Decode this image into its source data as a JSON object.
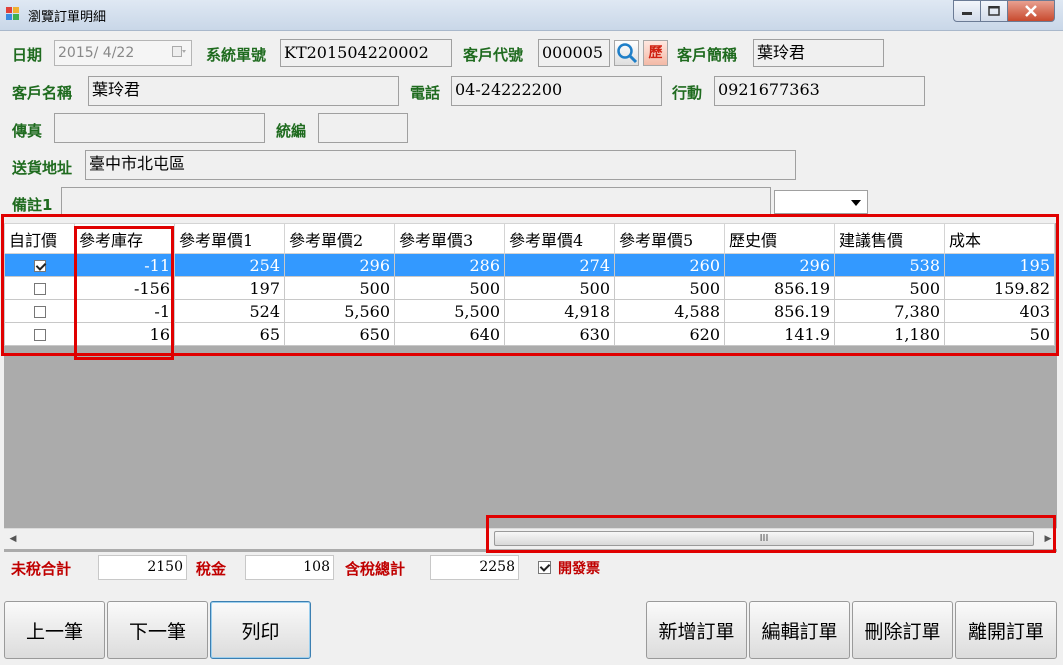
{
  "window": {
    "title": "瀏覽訂單明細"
  },
  "form": {
    "date_label": "日期",
    "date_value": "2015/ 4/22",
    "sysno_label": "系統單號",
    "sysno_value": "KT201504220002",
    "custcode_label": "客戶代號",
    "custcode_value": "000005",
    "history_btn": "歷",
    "shortname_label": "客戶簡稱",
    "shortname_value": "葉玲君",
    "custname_label": "客戶名稱",
    "custname_value": "葉玲君",
    "phone_label": "電話",
    "phone_value": "04-24222200",
    "mobile_label": "行動",
    "mobile_value": "0921677363",
    "fax_label": "傳真",
    "fax_value": "",
    "taxid_label": "統編",
    "taxid_value": "",
    "address_label": "送貨地址",
    "address_value": "臺中市北屯區",
    "note_label": "備註1",
    "note_value": ""
  },
  "grid": {
    "columns": [
      "自訂價",
      "參考庫存",
      "參考單價1",
      "參考單價2",
      "參考單價3",
      "參考單價4",
      "參考單價5",
      "歷史價",
      "建議售價",
      "成本"
    ],
    "rows": [
      {
        "checked": true,
        "cells": [
          "-11",
          "254",
          "296",
          "286",
          "274",
          "260",
          "296",
          "538",
          "195"
        ]
      },
      {
        "checked": false,
        "cells": [
          "-156",
          "197",
          "500",
          "500",
          "500",
          "500",
          "856.19",
          "500",
          "159.82"
        ]
      },
      {
        "checked": false,
        "cells": [
          "-1",
          "524",
          "5,560",
          "5,500",
          "4,918",
          "4,588",
          "856.19",
          "7,380",
          "403"
        ]
      },
      {
        "checked": false,
        "cells": [
          "16",
          "65",
          "650",
          "640",
          "630",
          "620",
          "141.9",
          "1,180",
          "50"
        ]
      }
    ],
    "scroll_grip": "III"
  },
  "totals": {
    "pretax_label": "未稅合計",
    "pretax_value": "2150",
    "tax_label": "稅金",
    "tax_value": "108",
    "total_label": "含稅總計",
    "total_value": "2258",
    "invoice_label": "開發票",
    "invoice_checked": true
  },
  "buttons": {
    "prev": "上一筆",
    "next": "下一筆",
    "print": "列印",
    "add": "新增訂單",
    "edit": "編輯訂單",
    "delete": "刪除訂單",
    "exit": "離開訂單"
  },
  "colors": {
    "selection": "#3399ff",
    "label_green": "#1f6b1f",
    "label_red": "#c00000",
    "highlight_box": "#e00000"
  }
}
